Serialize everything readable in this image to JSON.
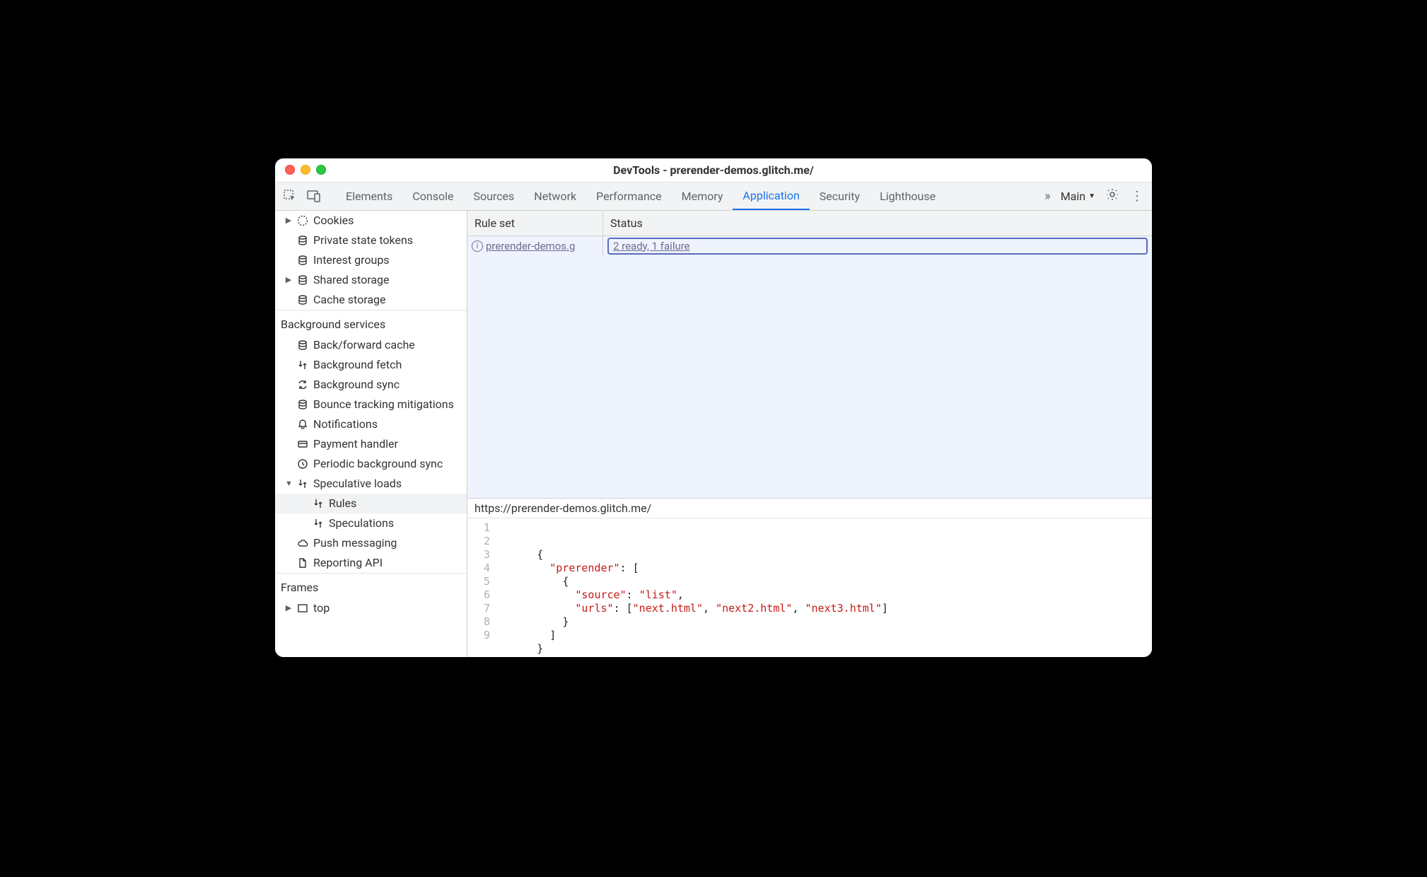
{
  "window": {
    "title": "DevTools - prerender-demos.glitch.me/"
  },
  "toolbar": {
    "tabs": {
      "elements": "Elements",
      "console": "Console",
      "sources": "Sources",
      "network": "Network",
      "performance": "Performance",
      "memory": "Memory",
      "application": "Application",
      "security": "Security",
      "lighthouse": "Lighthouse"
    },
    "mainLabel": "Main"
  },
  "sidebar": {
    "storage_items": {
      "cookies": "Cookies",
      "pst": "Private state tokens",
      "interest": "Interest groups",
      "shared": "Shared storage",
      "cache": "Cache storage"
    },
    "bg_section": "Background services",
    "bg_items": {
      "bfcache": "Back/forward cache",
      "bgfetch": "Background fetch",
      "bgsync": "Background sync",
      "bounce": "Bounce tracking mitigations",
      "notif": "Notifications",
      "payment": "Payment handler",
      "periodic": "Periodic background sync",
      "spec": "Speculative loads",
      "rules": "Rules",
      "specs": "Speculations",
      "push": "Push messaging",
      "reporting": "Reporting API"
    },
    "frames_section": "Frames",
    "frames_top": "top"
  },
  "grid": {
    "col1": "Rule set",
    "col2": "Status",
    "row1": {
      "ruleset": " prerender-demos.g",
      "status": "2 ready, 1 failure"
    }
  },
  "rules": {
    "url": "https://prerender-demos.glitch.me/",
    "lines": [
      "1",
      "2",
      "3",
      "4",
      "5",
      "6",
      "7",
      "8",
      "9"
    ],
    "code": {
      "l2_open": "{",
      "l3_key": "\"prerender\"",
      "l3_rest": ": [",
      "l4": "{",
      "l5_key": "\"source\"",
      "l5_mid": ": ",
      "l5_val": "\"list\"",
      "l5_end": ",",
      "l6_key": "\"urls\"",
      "l6_mid": ": [",
      "l6_v1": "\"next.html\"",
      "l6_c1": ", ",
      "l6_v2": "\"next2.html\"",
      "l6_c2": ", ",
      "l6_v3": "\"next3.html\"",
      "l6_end": "]",
      "l7": "}",
      "l8": "]",
      "l9": "}"
    }
  }
}
